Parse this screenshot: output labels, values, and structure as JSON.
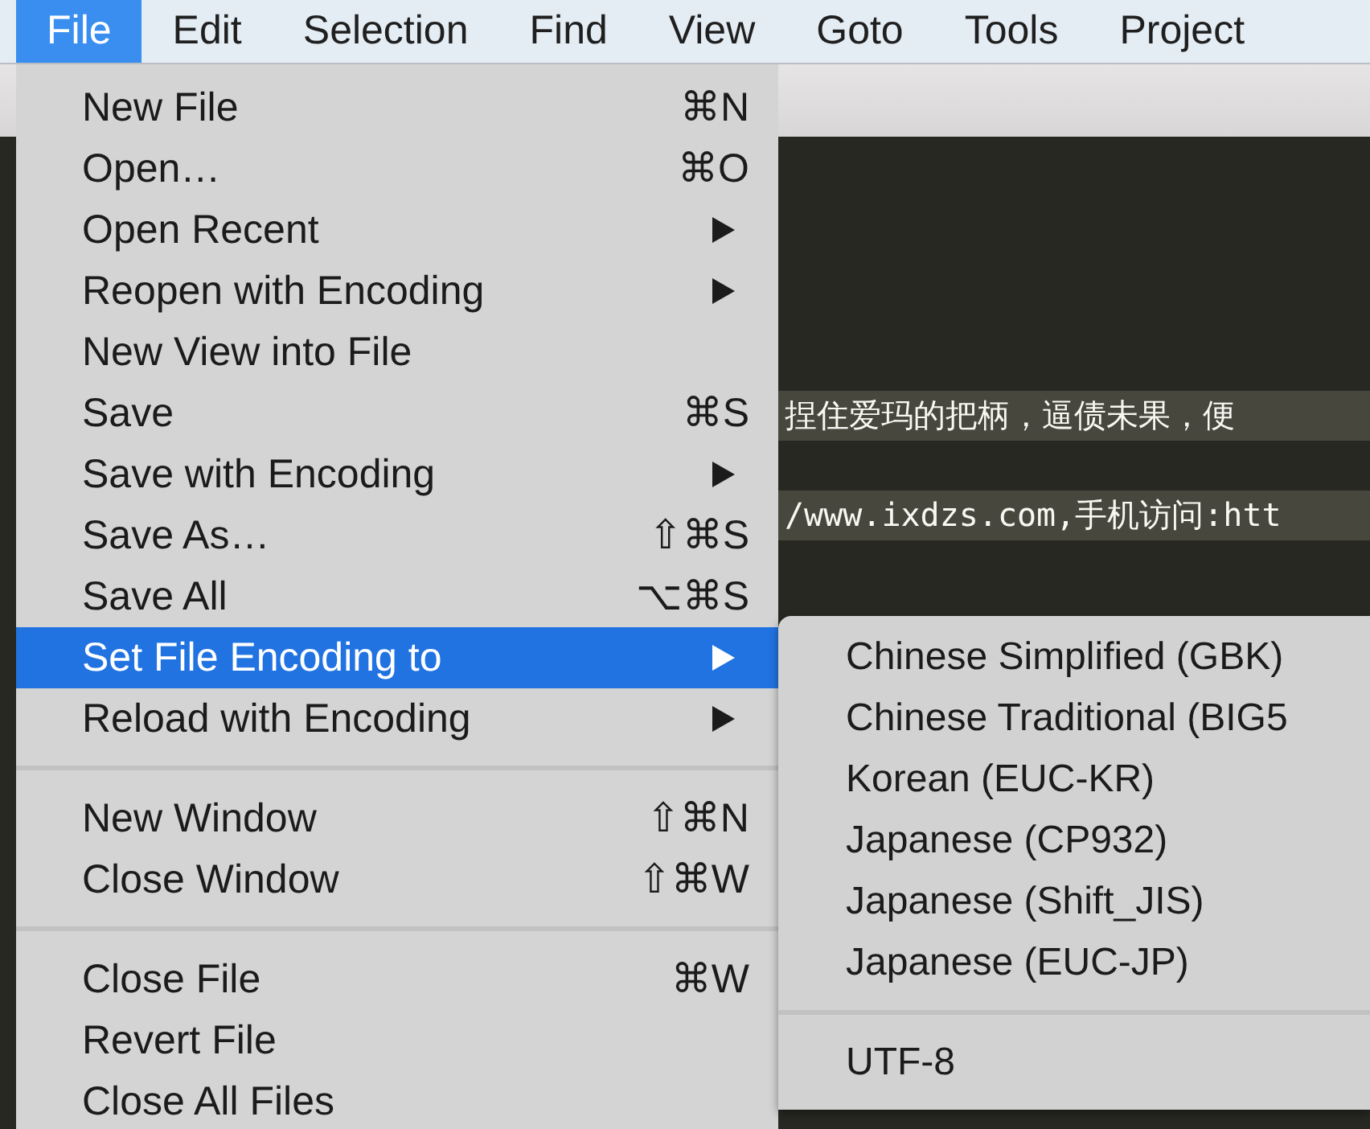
{
  "menu_bar": [
    {
      "label": "File",
      "selected": true
    },
    {
      "label": "Edit",
      "selected": false
    },
    {
      "label": "Selection",
      "selected": false
    },
    {
      "label": "Find",
      "selected": false
    },
    {
      "label": "View",
      "selected": false
    },
    {
      "label": "Goto",
      "selected": false
    },
    {
      "label": "Tools",
      "selected": false
    },
    {
      "label": "Project",
      "selected": false
    }
  ],
  "editor": {
    "lines": [
      "捏住爱玛的把柄，逼债未果，便",
      "/www.ixdzs.com,手机访问:htt"
    ]
  },
  "file_menu": {
    "groups": [
      [
        {
          "label": "New File",
          "shortcut": "⌘N",
          "has_submenu": false,
          "selected": false
        },
        {
          "label": "Open…",
          "shortcut": "⌘O",
          "has_submenu": false,
          "selected": false
        },
        {
          "label": "Open Recent",
          "has_submenu": true,
          "selected": false
        },
        {
          "label": "Reopen with Encoding",
          "has_submenu": true,
          "selected": false
        },
        {
          "label": "New View into File",
          "has_submenu": false,
          "selected": false
        },
        {
          "label": "Save",
          "shortcut": "⌘S",
          "has_submenu": false,
          "selected": false
        },
        {
          "label": "Save with Encoding",
          "has_submenu": true,
          "selected": false
        },
        {
          "label": "Save As…",
          "shortcut": "⇧⌘S",
          "has_submenu": false,
          "selected": false
        },
        {
          "label": "Save All",
          "shortcut": "⌥⌘S",
          "has_submenu": false,
          "selected": false
        },
        {
          "label": "Set File Encoding to",
          "has_submenu": true,
          "selected": true
        },
        {
          "label": "Reload with Encoding",
          "has_submenu": true,
          "selected": false
        }
      ],
      [
        {
          "label": "New Window",
          "shortcut": "⇧⌘N",
          "has_submenu": false,
          "selected": false
        },
        {
          "label": "Close Window",
          "shortcut": "⇧⌘W",
          "has_submenu": false,
          "selected": false
        }
      ],
      [
        {
          "label": "Close File",
          "shortcut": "⌘W",
          "has_submenu": false,
          "selected": false
        },
        {
          "label": "Revert File",
          "has_submenu": false,
          "selected": false
        },
        {
          "label": "Close All Files",
          "has_submenu": false,
          "selected": false
        }
      ]
    ]
  },
  "encoding_submenu": {
    "groups": [
      [
        "Chinese Simplified (GBK)",
        "Chinese Traditional (BIG5",
        "Korean (EUC-KR)",
        "Japanese (CP932)",
        "Japanese (Shift_JIS)",
        "Japanese (EUC-JP)"
      ],
      [
        "UTF-8"
      ]
    ]
  }
}
